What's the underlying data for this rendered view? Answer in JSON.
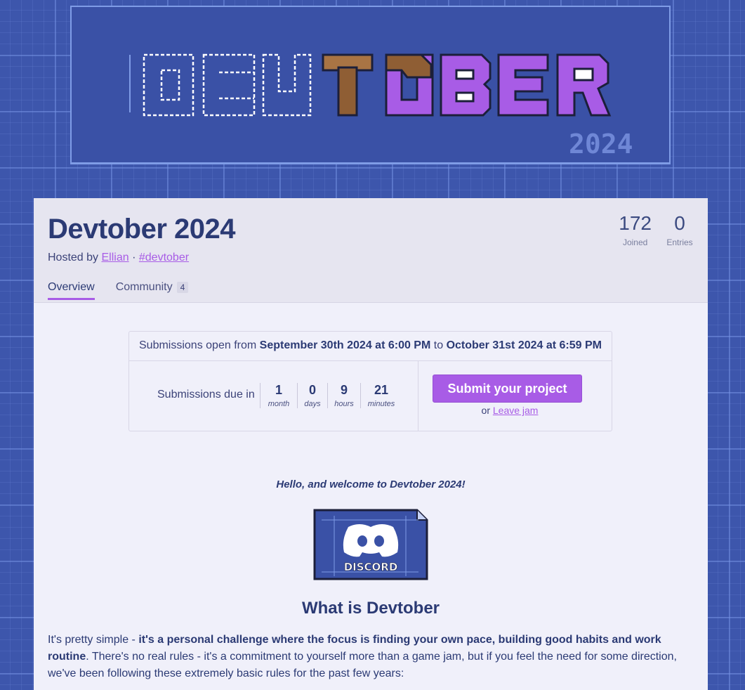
{
  "banner": {
    "logo_letters": [
      "D",
      "E",
      "V",
      "T",
      "O",
      "B",
      "E",
      "R"
    ],
    "logo_year": "2024"
  },
  "jam": {
    "title": "Devtober 2024",
    "hosted_by_prefix": "Hosted by",
    "host": "Ellian",
    "separator": "·",
    "tag": "#devtober"
  },
  "stats": [
    {
      "value": "172",
      "label": "Joined"
    },
    {
      "value": "0",
      "label": "Entries"
    }
  ],
  "tabs": [
    {
      "label": "Overview",
      "active": true
    },
    {
      "label": "Community",
      "count": "4"
    }
  ],
  "submission": {
    "open_prefix": "Submissions open from",
    "start": "September 30th 2024 at 6:00 PM",
    "to": "to",
    "end": "October 31st 2024 at 6:59 PM",
    "due_label": "Submissions due in",
    "countdown": [
      {
        "value": "1",
        "unit": "month"
      },
      {
        "value": "0",
        "unit": "days"
      },
      {
        "value": "9",
        "unit": "hours"
      },
      {
        "value": "21",
        "unit": "minutes"
      }
    ],
    "submit_label": "Submit your project",
    "leave_prefix": "or",
    "leave_label": "Leave jam"
  },
  "content": {
    "welcome": "Hello, and welcome to Devtober 2024!",
    "discord_label": "DISCORD",
    "section_title": "What is Devtober",
    "para_intro": "It's pretty simple - ",
    "para_bold": "it's a personal challenge where the focus is finding your own pace, building good habits and work routine",
    "para_rest": ". There's no real rules - it's a commitment to yourself more than a game jam, but if you feel the need for some direction, we've been following these extremely basic rules for the past few years:"
  },
  "colors": {
    "accent": "#a85ce6",
    "title": "#2b3a74",
    "background": "#3d56ac",
    "card": "#f0f0fa"
  }
}
